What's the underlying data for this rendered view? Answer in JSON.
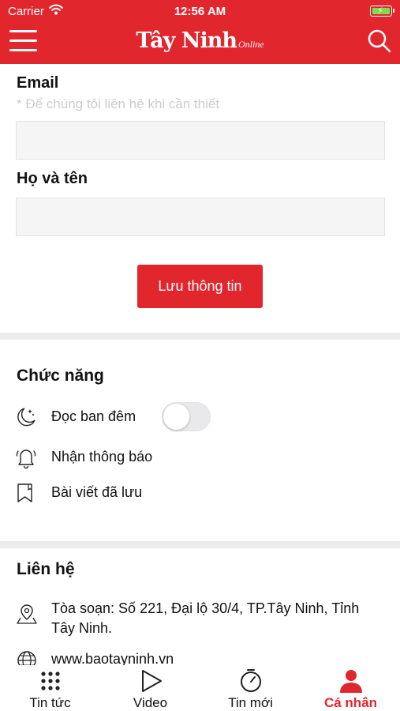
{
  "status_bar": {
    "carrier": "Carrier",
    "time": "12:56 AM"
  },
  "header": {
    "logo_main": "Tây Ninh",
    "logo_sub": "Online"
  },
  "form": {
    "email_label": "Email",
    "email_hint": "* Để chúng tôi liên hệ khi cần thiết",
    "email_value": "",
    "name_label": "Họ và tên",
    "name_value": "",
    "save_label": "Lưu thông tin"
  },
  "features": {
    "title": "Chức năng",
    "items": [
      {
        "label": "Đọc ban đêm",
        "icon": "night-mode-icon",
        "toggle_on": false
      },
      {
        "label": "Nhận thông báo",
        "icon": "bell-icon"
      },
      {
        "label": "Bài viết đã lưu",
        "icon": "bookmark-icon"
      }
    ]
  },
  "contact": {
    "title": "Liên hệ",
    "address": "Tòa soạn: Số 221, Đại lộ 30/4, TP.Tây Ninh, Tỉnh Tây Ninh.",
    "website": "www.baotayninh.vn"
  },
  "tabbar": {
    "items": [
      {
        "label": "Tin tức",
        "icon": "grid-icon"
      },
      {
        "label": "Video",
        "icon": "play-icon"
      },
      {
        "label": "Tin mới",
        "icon": "timer-icon"
      },
      {
        "label": "Cá nhân",
        "icon": "person-icon"
      }
    ],
    "active_index": 3
  },
  "colors": {
    "brand": "#e1262d",
    "separator": "#ececec",
    "hint": "#cccccc"
  }
}
